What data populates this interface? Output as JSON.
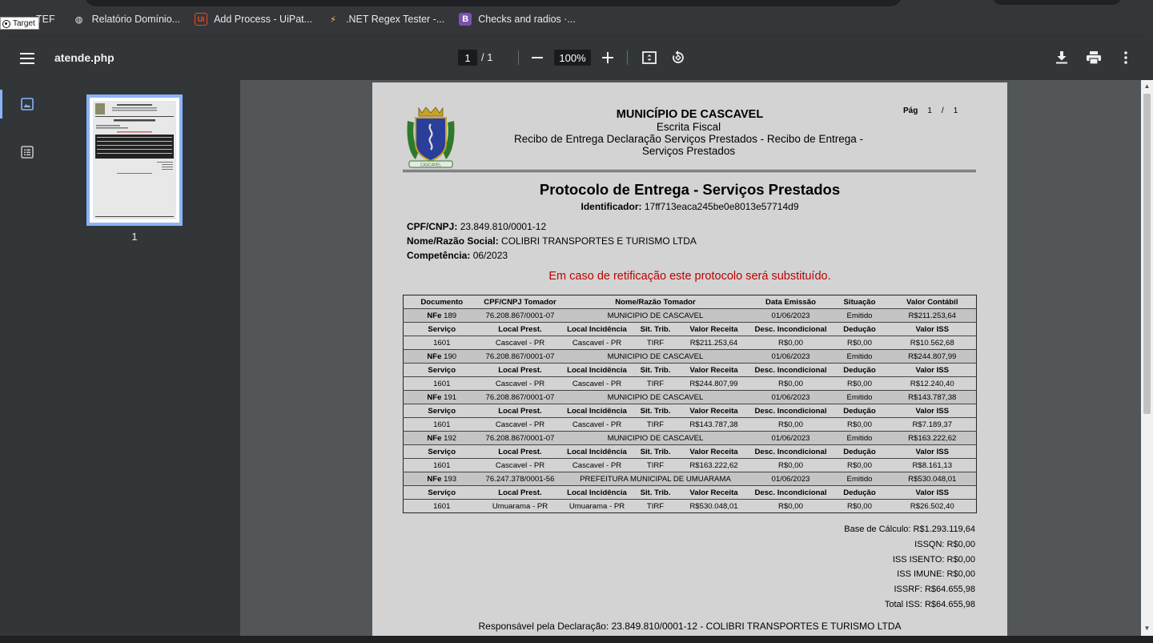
{
  "browser": {
    "bookmarks": [
      {
        "label": "TEF",
        "icon": "generic-icon"
      },
      {
        "label": "Relatório Domínio...",
        "icon": "globe-icon"
      },
      {
        "label": "Add Process - UiPat...",
        "icon": "uipath-icon"
      },
      {
        "label": ".NET Regex Tester -...",
        "icon": "bolt-icon"
      },
      {
        "label": "Checks and radios ·...",
        "icon": "bootstrap-icon"
      }
    ],
    "tooltip": "Target"
  },
  "toolbar": {
    "file_name": "atende.php",
    "current_page": "1",
    "total_pages": "/  1",
    "zoom": "100%"
  },
  "sidebar": {
    "thumbnail_label": "1"
  },
  "document": {
    "header": {
      "municipality": "MUNICÍPIO DE CASCAVEL",
      "subtitle": "Escrita Fiscal",
      "report_line1": "Recibo de Entrega Declaração Serviços Prestados - Recibo de Entrega -",
      "report_line2": "Serviços Prestados",
      "page_label": "Pág",
      "page_current": "1",
      "page_slash": "/",
      "page_total": "1",
      "crest_text": "CASCAVEL"
    },
    "title": "Protocolo de Entrega - Serviços Prestados",
    "identifier_label": "Identificador:",
    "identifier_value": "17ff713eaca245be0e8013e57714d9",
    "cpf_label": "CPF/CNPJ:",
    "cpf_value": "23.849.810/0001-12",
    "name_label": "Nome/Razão Social:",
    "name_value": "COLIBRI TRANSPORTES E TURISMO LTDA",
    "competencia_label": "Competência:",
    "competencia_value": "06/2023",
    "warning": "Em caso de retificação este protocolo será substituído.",
    "table": {
      "headers": [
        "Documento",
        "CPF/CNPJ Tomador",
        "Nome/Razão Tomador",
        "Data Emissão",
        "Situação",
        "Valor Contábil"
      ],
      "sub_headers": [
        "Serviço",
        "Local Prest.",
        "Local Incidência",
        "Sit. Trib.",
        "Valor Receita",
        "Desc. Incondicional",
        "Dedução",
        "Valor ISS"
      ],
      "doc_prefix": "NFe",
      "entries": [
        {
          "doc": "189",
          "cpf": "76.208.867/0001-07",
          "nome": "MUNICIPIO DE CASCAVEL",
          "data": "01/06/2023",
          "situacao": "Emitido",
          "valor_contabil": "R$211.253,64",
          "servico": "1601",
          "local_prest": "Cascavel - PR",
          "local_inc": "Cascavel - PR",
          "sit_trib": "TIRF",
          "valor_receita": "R$211.253,64",
          "desc": "R$0,00",
          "deducao": "R$0,00",
          "valor_iss": "R$10.562,68"
        },
        {
          "doc": "190",
          "cpf": "76.208.867/0001-07",
          "nome": "MUNICIPIO DE CASCAVEL",
          "data": "01/06/2023",
          "situacao": "Emitido",
          "valor_contabil": "R$244.807,99",
          "servico": "1601",
          "local_prest": "Cascavel - PR",
          "local_inc": "Cascavel - PR",
          "sit_trib": "TIRF",
          "valor_receita": "R$244.807,99",
          "desc": "R$0,00",
          "deducao": "R$0,00",
          "valor_iss": "R$12.240,40"
        },
        {
          "doc": "191",
          "cpf": "76.208.867/0001-07",
          "nome": "MUNICIPIO DE CASCAVEL",
          "data": "01/06/2023",
          "situacao": "Emitido",
          "valor_contabil": "R$143.787,38",
          "servico": "1601",
          "local_prest": "Cascavel - PR",
          "local_inc": "Cascavel - PR",
          "sit_trib": "TIRF",
          "valor_receita": "R$143.787,38",
          "desc": "R$0,00",
          "deducao": "R$0,00",
          "valor_iss": "R$7.189,37"
        },
        {
          "doc": "192",
          "cpf": "76.208.867/0001-07",
          "nome": "MUNICIPIO DE CASCAVEL",
          "data": "01/06/2023",
          "situacao": "Emitido",
          "valor_contabil": "R$163.222,62",
          "servico": "1601",
          "local_prest": "Cascavel - PR",
          "local_inc": "Cascavel - PR",
          "sit_trib": "TIRF",
          "valor_receita": "R$163.222,62",
          "desc": "R$0,00",
          "deducao": "R$0,00",
          "valor_iss": "R$8.161,13"
        },
        {
          "doc": "193",
          "cpf": "76.247.378/0001-56",
          "nome": "PREFEITURA MUNICIPAL DE UMUARAMA",
          "data": "01/06/2023",
          "situacao": "Emitido",
          "valor_contabil": "R$530.048,01",
          "servico": "1601",
          "local_prest": "Umuarama - PR",
          "local_inc": "Umuarama - PR",
          "sit_trib": "TIRF",
          "valor_receita": "R$530.048,01",
          "desc": "R$0,00",
          "deducao": "R$0,00",
          "valor_iss": "R$26.502,40"
        }
      ]
    },
    "totals": [
      "Base de Cálculo: R$1.293.119,64",
      "ISSQN: R$0,00",
      "ISS ISENTO: R$0,00",
      "ISS IMUNE: R$0,00",
      "ISSRF: R$64.655,98",
      "Total ISS: R$64.655,98"
    ],
    "responsible": "Responsável pela Declaração: 23.849.810/0001-12 - COLIBRI TRANSPORTES E TURISMO LTDA"
  },
  "colors": {
    "toolbar_bg": "#323639",
    "viewer_bg": "#525659",
    "accent": "#8ab4f8",
    "warning_red": "#c00000",
    "page_bg": "#d3d3d3"
  }
}
